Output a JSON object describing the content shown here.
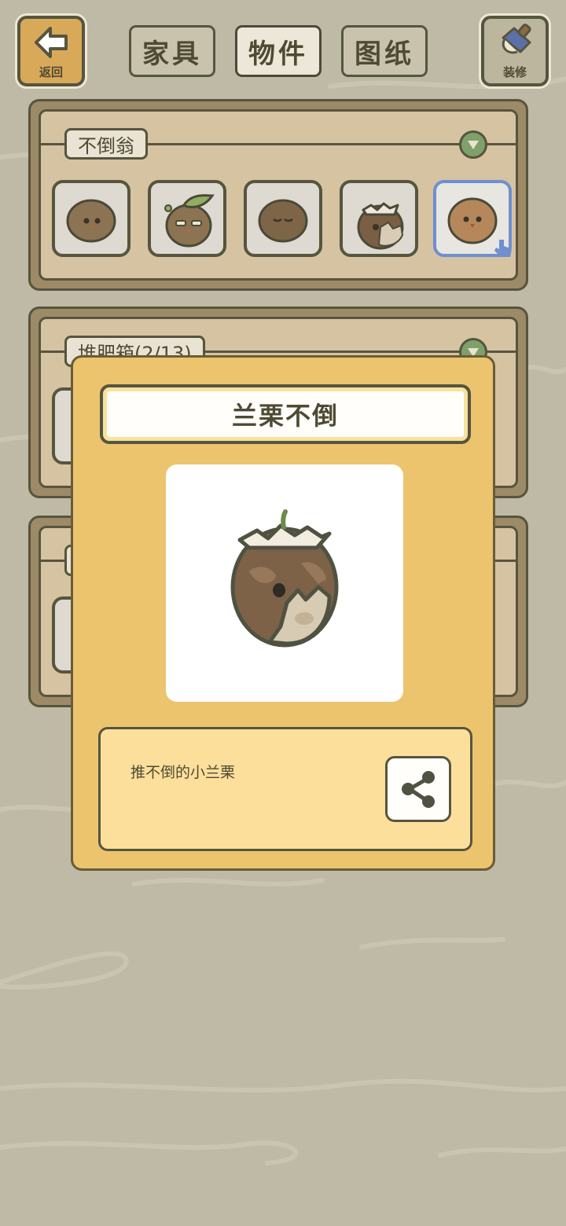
{
  "topbar": {
    "back_label": "返回",
    "decorate_label": "装修",
    "tabs": [
      {
        "label": "家具",
        "active": false
      },
      {
        "label": "物件",
        "active": true
      },
      {
        "label": "图纸",
        "active": false
      }
    ]
  },
  "panels": [
    {
      "title": "不倒翁",
      "items": [
        "acorn-plain",
        "acorn-leaf-owl",
        "acorn-sleepy",
        "acorn-cracked",
        "acorn-bird"
      ],
      "selected_index": 4
    },
    {
      "title": "堆肥箱(2/13)"
    },
    {
      "title": ""
    }
  ],
  "popup": {
    "title": "兰栗不倒",
    "description": "推不倒的小兰栗",
    "share_icon": "share-icon"
  },
  "colors": {
    "background": "#bfbaa5",
    "popup": "#ecc46e",
    "selected_border": "#6f8fd0",
    "toggle": "#7fa06a"
  }
}
